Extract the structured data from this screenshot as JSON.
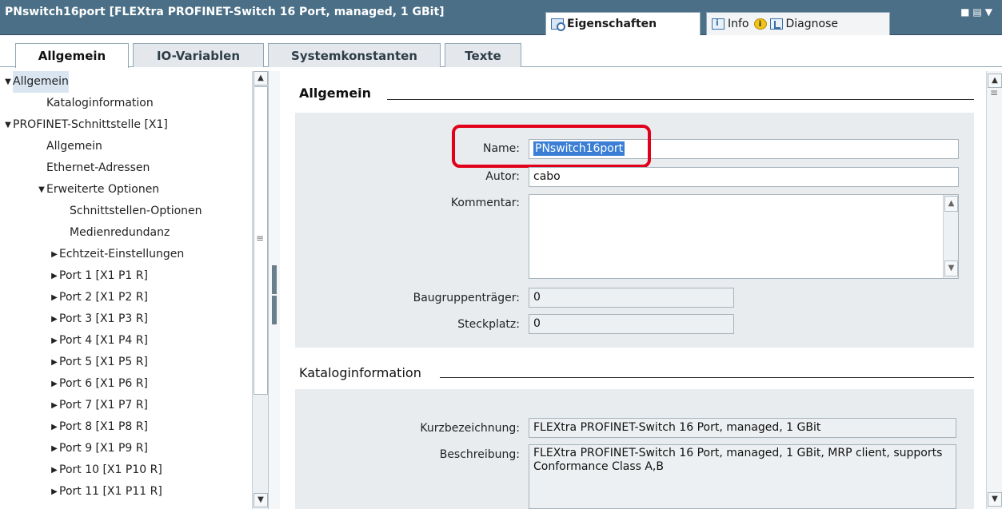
{
  "titlebar": {
    "title": "PNswitch16port [FLEXtra PROFINET-Switch 16 Port, managed, 1 GBit]",
    "tabs": [
      {
        "label": "Eigenschaften",
        "icon": "properties-icon"
      },
      {
        "label": "Info",
        "icon": "info-icon"
      },
      {
        "label": "Diagnose",
        "icon": "diagnose-icon"
      }
    ],
    "controls": "■▤▼"
  },
  "inspector_tabs": [
    "Allgemein",
    "IO-Variablen",
    "Systemkonstanten",
    "Texte"
  ],
  "tree": [
    {
      "label": "Allgemein",
      "arrow": "▼"
    },
    {
      "label": "Kataloginformation",
      "arrow": ""
    },
    {
      "label": "PROFINET-Schnittstelle [X1]",
      "arrow": "▼"
    },
    {
      "label": "Allgemein",
      "arrow": ""
    },
    {
      "label": "Ethernet-Adressen",
      "arrow": ""
    },
    {
      "label": "Erweiterte Optionen",
      "arrow": "▼"
    },
    {
      "label": "Schnittstellen-Optionen",
      "arrow": ""
    },
    {
      "label": "Medienredundanz",
      "arrow": ""
    },
    {
      "label": "Echtzeit-Einstellungen",
      "arrow": "▶"
    },
    {
      "label": "Port 1 [X1 P1 R]",
      "arrow": "▶"
    },
    {
      "label": "Port 2 [X1 P2 R]",
      "arrow": "▶"
    },
    {
      "label": "Port 3 [X1 P3 R]",
      "arrow": "▶"
    },
    {
      "label": "Port 4 [X1 P4 R]",
      "arrow": "▶"
    },
    {
      "label": "Port 5 [X1 P5 R]",
      "arrow": "▶"
    },
    {
      "label": "Port 6 [X1 P6 R]",
      "arrow": "▶"
    },
    {
      "label": "Port 7 [X1 P7 R]",
      "arrow": "▶"
    },
    {
      "label": "Port 8 [X1 P8 R]",
      "arrow": "▶"
    },
    {
      "label": "Port 9 [X1 P9 R]",
      "arrow": "▶"
    },
    {
      "label": "Port 10 [X1 P10 R]",
      "arrow": "▶"
    },
    {
      "label": "Port 11 [X1 P11 R]",
      "arrow": "▶"
    }
  ],
  "allgemein": {
    "heading": "Allgemein",
    "name_label": "Name:",
    "name_value": "PNswitch16port",
    "autor_label": "Autor:",
    "autor_value": "cabo",
    "kommentar_label": "Kommentar:",
    "kommentar_value": "",
    "traeger_label": "Baugruppenträger:",
    "traeger_value": "0",
    "steckplatz_label": "Steckplatz:",
    "steckplatz_value": "0"
  },
  "kataloginformation": {
    "heading": "Kataloginformation",
    "kurz_label": "Kurzbezeichnung:",
    "kurz_value": "FLEXtra PROFINET-Switch 16 Port, managed, 1 GBit",
    "beschreibung_label": "Beschreibung:",
    "beschreibung_value": "FLEXtra PROFINET-Switch 16 Port, managed, 1 GBit, MRP client, supports Conformance Class A,B"
  },
  "colors": {
    "titlebar": "#4a6f86",
    "highlight": "#e0001a",
    "selection": "#3a7fd5"
  }
}
